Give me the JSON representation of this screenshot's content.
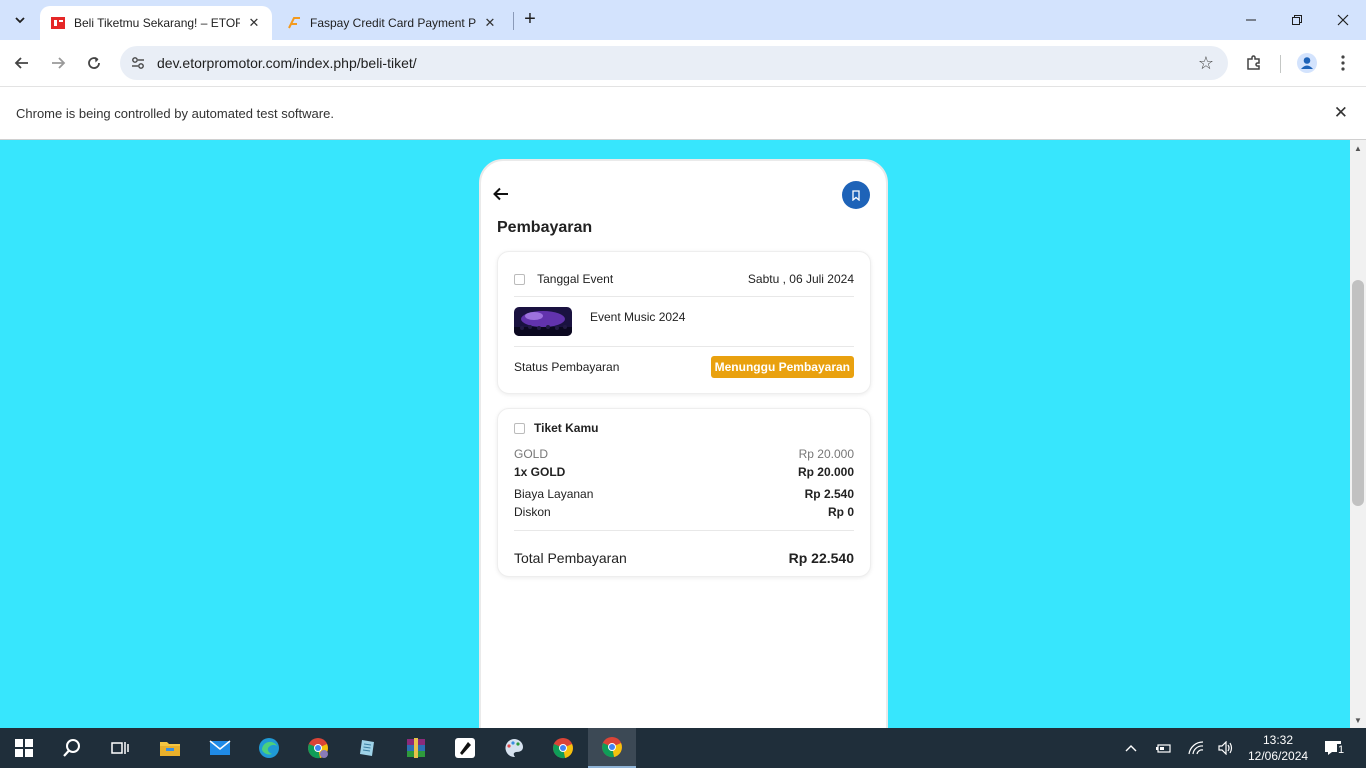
{
  "browser": {
    "tabs": [
      {
        "title": "Beli Tiketmu Sekarang! – ETOR",
        "active": true
      },
      {
        "title": "Faspay Credit Card Payment Pa",
        "active": false
      }
    ],
    "url": "dev.etorpromotor.com/index.php/beli-tiket/",
    "infobar_text": "Chrome is being controlled by automated test software."
  },
  "page": {
    "title": "Pembayaran",
    "background_color": "#37e6fd",
    "accent_color": "#1e63b8",
    "event_card": {
      "date_label": "Tanggal Event",
      "date_value": "Sabtu , 06 Juli 2024",
      "event_name": "Event Music 2024",
      "status_label": "Status Pembayaran",
      "status_value": "Menunggu Pembayaran",
      "status_color": "#e9a10f"
    },
    "ticket_card": {
      "title": "Tiket Kamu",
      "ticket_type": "GOLD",
      "ticket_price": "Rp 20.000",
      "ticket_qty_label": "1x GOLD",
      "ticket_subtotal": "Rp 20.000",
      "service_fee_label": "Biaya Layanan",
      "service_fee_value": "Rp 2.540",
      "discount_label": "Diskon",
      "discount_value": "Rp 0",
      "total_label": "Total Pembayaran",
      "total_value": "Rp 22.540"
    }
  },
  "taskbar": {
    "time": "13:32",
    "date": "12/06/2024",
    "notification_count": "1"
  }
}
